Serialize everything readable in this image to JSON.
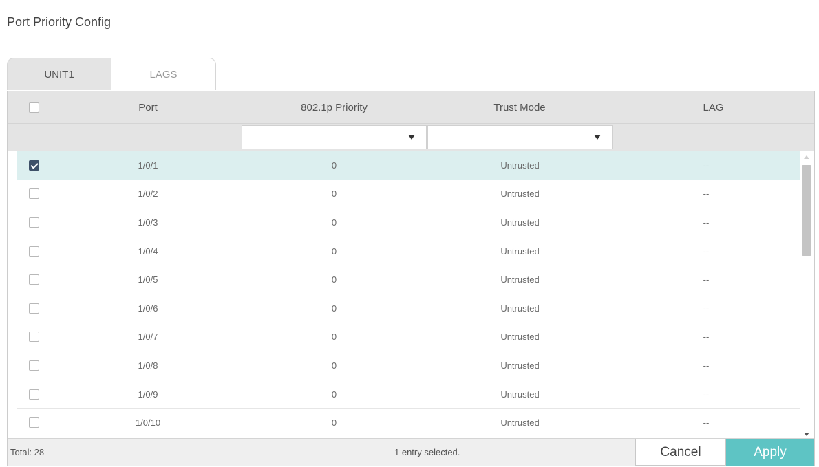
{
  "page": {
    "title": "Port Priority Config"
  },
  "tabs": [
    {
      "label": "UNIT1",
      "active": true
    },
    {
      "label": "LAGS",
      "active": false
    }
  ],
  "table": {
    "columns": [
      "Port",
      "802.1p Priority",
      "Trust Mode",
      "LAG"
    ],
    "filter": {
      "priority_value": "",
      "trust_mode_value": ""
    },
    "rows": [
      {
        "port": "1/0/1",
        "priority": "0",
        "trust_mode": "Untrusted",
        "lag": "--",
        "checked": true
      },
      {
        "port": "1/0/2",
        "priority": "0",
        "trust_mode": "Untrusted",
        "lag": "--",
        "checked": false
      },
      {
        "port": "1/0/3",
        "priority": "0",
        "trust_mode": "Untrusted",
        "lag": "--",
        "checked": false
      },
      {
        "port": "1/0/4",
        "priority": "0",
        "trust_mode": "Untrusted",
        "lag": "--",
        "checked": false
      },
      {
        "port": "1/0/5",
        "priority": "0",
        "trust_mode": "Untrusted",
        "lag": "--",
        "checked": false
      },
      {
        "port": "1/0/6",
        "priority": "0",
        "trust_mode": "Untrusted",
        "lag": "--",
        "checked": false
      },
      {
        "port": "1/0/7",
        "priority": "0",
        "trust_mode": "Untrusted",
        "lag": "--",
        "checked": false
      },
      {
        "port": "1/0/8",
        "priority": "0",
        "trust_mode": "Untrusted",
        "lag": "--",
        "checked": false
      },
      {
        "port": "1/0/9",
        "priority": "0",
        "trust_mode": "Untrusted",
        "lag": "--",
        "checked": false
      },
      {
        "port": "1/0/10",
        "priority": "0",
        "trust_mode": "Untrusted",
        "lag": "--",
        "checked": false
      }
    ]
  },
  "footer": {
    "total": "Total: 28",
    "selected_info": "1 entry selected.",
    "cancel_label": "Cancel",
    "apply_label": "Apply"
  },
  "colors": {
    "accent": "#5ec4c4",
    "selected_row": "#dcefef",
    "header_bg": "#e4e4e4"
  }
}
